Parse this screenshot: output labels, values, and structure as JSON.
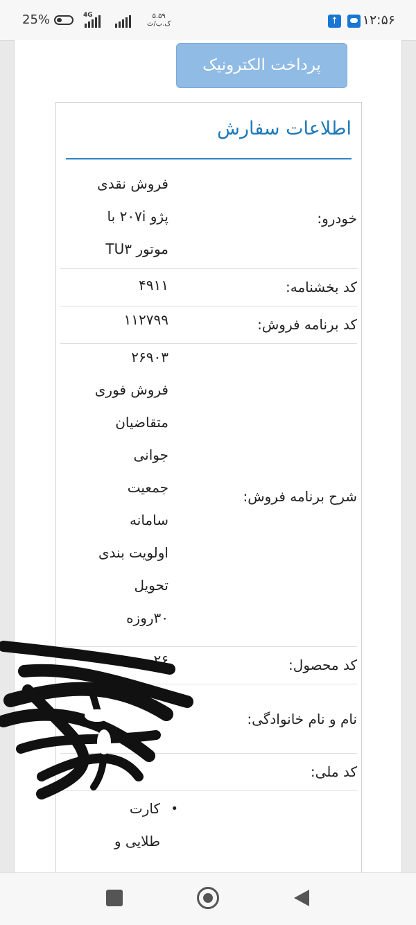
{
  "status_bar": {
    "time": "۱۲:۵۶",
    "battery_percent": "25%",
    "network_label": "4G",
    "speed_value": "۵.۵۹",
    "speed_unit": "ک.ب/ث"
  },
  "page": {
    "pay_button_label": "پرداخت الکترونیک",
    "order_title": "اطلاعات سفارش",
    "rows": [
      {
        "label": "خودرو:",
        "value_lines": [
          "فروش نقدی",
          "پژو ۲۰۷i با",
          "موتور TU۳"
        ]
      },
      {
        "label": "کد بخشنامه:",
        "value_lines": [
          "۴۹۱۱"
        ]
      },
      {
        "label": "کد برنامه فروش:",
        "value_lines": [
          "۱۱۲۷۹۹"
        ]
      },
      {
        "label": "شرح برنامه فروش:",
        "value_lines": [
          "۲۶۹۰۳",
          "فروش فوری",
          "متقاضیان",
          "جوانی",
          "جمعیت",
          "سامانه",
          "اولویت بندی",
          "تحویل",
          "۳۰روزه"
        ]
      },
      {
        "label": "کد محصول:",
        "value_lines": [
          "۲۶"
        ]
      },
      {
        "label": "نام و نام خانوادگی:",
        "value_lines": []
      },
      {
        "label": "کد ملی:",
        "value_lines": []
      }
    ],
    "bullet_item_lines": [
      "کارت",
      "طلایی و"
    ]
  },
  "colors": {
    "accent": "#1f7ab8",
    "button": "#8fbbe4"
  }
}
